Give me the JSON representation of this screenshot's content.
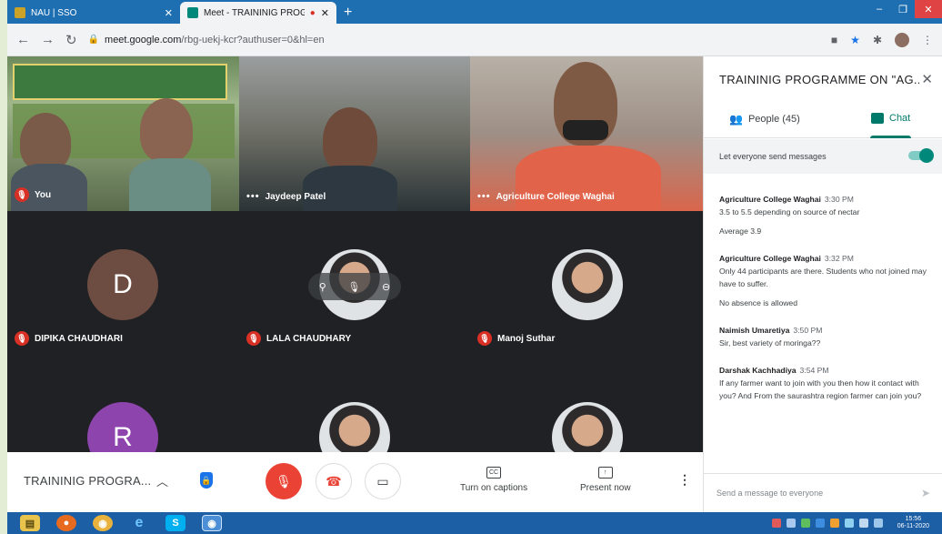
{
  "browser": {
    "tabs": [
      {
        "title": "NAU | SSO",
        "active": false
      },
      {
        "title": "Meet - TRAININIG PROGRAI",
        "active": true,
        "recording": true
      }
    ],
    "new_tab": "+",
    "url_host": "meet.google.com",
    "url_path": "/rbg-uekj-kcr?authuser=0&hl=en"
  },
  "tiles": {
    "you": {
      "name": "You",
      "muted": true
    },
    "jaydeep": {
      "name": "Jaydeep Patel"
    },
    "agri": {
      "name": "Agriculture College Waghai"
    },
    "dipika": {
      "name": "DIPIKA CHAUDHARI",
      "initial": "D",
      "muted": true,
      "color": "#6d4c41"
    },
    "lala": {
      "name": "LALA CHAUDHARY",
      "muted": true
    },
    "manoj": {
      "name": "Manoj Suthar",
      "muted": true
    },
    "r": {
      "initial": "R",
      "color": "#8e44ad"
    }
  },
  "controls": {
    "meeting_title": "TRAININIG PROGRA...",
    "captions_label": "Turn on captions",
    "captions_icon": "CC",
    "present_label": "Present now"
  },
  "panel": {
    "title": "TRAININIG PROGRAMME ON \"AG...",
    "people_label": "People (45)",
    "chat_label": "Chat",
    "let_everyone": "Let everyone send messages",
    "messages": [
      {
        "sender": "Agriculture College Waghai",
        "time": "3:30 PM",
        "lines": [
          "3.5 to 5.5 depending on source of nectar",
          "Average 3.9"
        ]
      },
      {
        "sender": "Agriculture College Waghai",
        "time": "3:32 PM",
        "lines": [
          "Only 44 participants are there. Students who  not joined may  have to suffer.",
          "No absence is allowed"
        ]
      },
      {
        "sender": "Naimish Umaretiya",
        "time": "3:50 PM",
        "lines": [
          "Sir, best variety of moringa??"
        ]
      },
      {
        "sender": "Darshak Kachhadiya",
        "time": "3:54 PM",
        "lines": [
          "If any farmer want to join with you then how it contact with you?  And From the saurashtra region farmer can join you?"
        ]
      }
    ],
    "send_placeholder": "Send a message to everyone"
  },
  "taskbar": {
    "clock_time": "15:56",
    "clock_date": "06-11-2020"
  },
  "colors": {
    "accent": "#00796b",
    "mute_red": "#ea4335",
    "meet_bg": "#202124",
    "tab_strip": "#1e6fb2",
    "taskbar": "#1c5fa5"
  }
}
